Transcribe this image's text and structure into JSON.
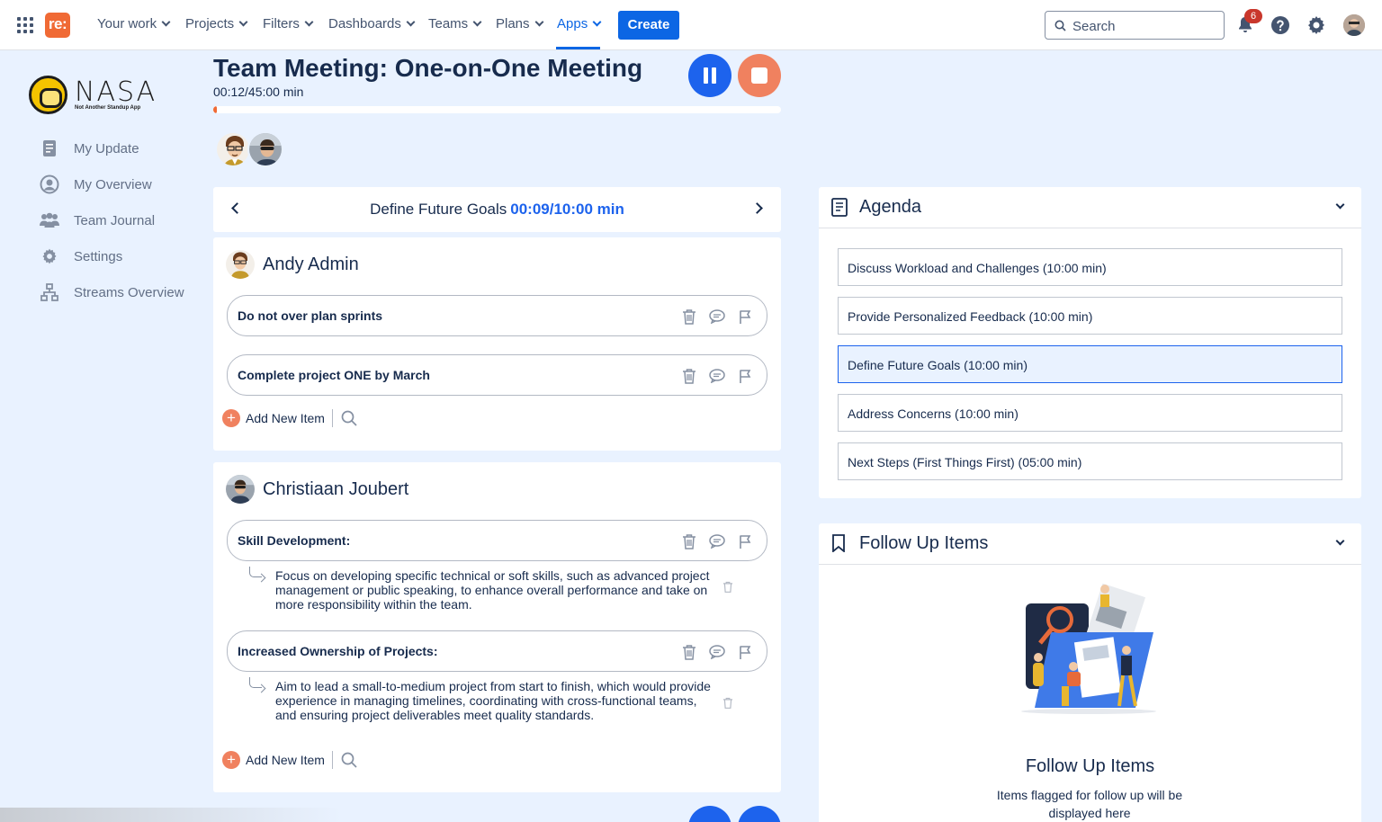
{
  "topnav": {
    "logo": "re:",
    "items": [
      {
        "label": "Your work"
      },
      {
        "label": "Projects"
      },
      {
        "label": "Filters"
      },
      {
        "label": "Dashboards"
      },
      {
        "label": "Teams"
      },
      {
        "label": "Plans"
      },
      {
        "label": "Apps",
        "active": true
      }
    ],
    "create_label": "Create",
    "search_placeholder": "Search",
    "notification_count": "6"
  },
  "sidebar": {
    "brand_name": "NASA",
    "brand_tagline": "Not Another Standup App",
    "items": [
      {
        "label": "My Update",
        "icon": "document-icon"
      },
      {
        "label": "My Overview",
        "icon": "user-circle-icon"
      },
      {
        "label": "Team Journal",
        "icon": "people-icon"
      },
      {
        "label": "Settings",
        "icon": "gear-icon"
      },
      {
        "label": "Streams Overview",
        "icon": "hierarchy-icon"
      }
    ]
  },
  "meeting": {
    "title": "Team Meeting: One-on-One Meeting",
    "elapsed": "00:12/45:00 min",
    "progress_fraction": 0.004,
    "colors": {
      "accent": "#1d63ed",
      "orange": "#f06a35"
    }
  },
  "topic": {
    "title": "Define Future Goals",
    "timer": "00:09/10:00 min"
  },
  "people": [
    {
      "name": "Andy Admin",
      "items": [
        {
          "text": "Do not over plan sprints"
        },
        {
          "text": "Complete project ONE by March"
        }
      ],
      "add_label": "Add New Item"
    },
    {
      "name": "Christiaan Joubert",
      "items": [
        {
          "text": "Skill Development:",
          "sub": "Focus on developing specific technical or soft skills, such as advanced project management or public speaking, to enhance overall performance and take on more responsibility within the team."
        },
        {
          "text": "Increased Ownership of Projects:",
          "sub": "Aim to lead a small-to-medium project from start to finish, which would provide experience in managing timelines, coordinating with cross-functional teams, and ensuring project deliverables meet quality standards."
        }
      ],
      "add_label": "Add New Item"
    }
  ],
  "agenda": {
    "title": "Agenda",
    "items": [
      {
        "label": "Discuss Workload and Challenges (10:00 min)"
      },
      {
        "label": "Provide Personalized Feedback (10:00 min)"
      },
      {
        "label": "Define Future Goals (10:00 min)",
        "active": true
      },
      {
        "label": "Address Concerns (10:00 min)"
      },
      {
        "label": "Next Steps (First Things First) (05:00 min)"
      }
    ]
  },
  "followup": {
    "title": "Follow Up Items",
    "empty_title": "Follow Up Items",
    "empty_desc": "Items flagged for follow up will be displayed here"
  }
}
